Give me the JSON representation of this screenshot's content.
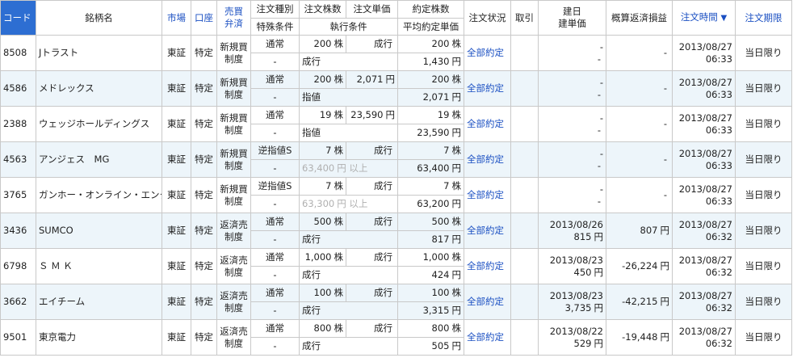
{
  "headers": {
    "code": "コード",
    "name": "銘柄名",
    "market": "市場",
    "account": "口座",
    "buysell_line1": "売買",
    "buysell_line2": "弁済",
    "order_type": "注文種別",
    "special": "特殊条件",
    "qty": "注文株数",
    "exec_cond": "執行条件",
    "price": "注文単価",
    "filled_qty": "約定株数",
    "avg_price": "平均約定単価",
    "status": "注文状況",
    "cancel": "取引",
    "open_date_line1": "建日",
    "open_date_line2": "建単価",
    "pnl": "概算返済損益",
    "order_time": "注文時間",
    "sort_arrow": "▼",
    "expiry": "注文期限"
  },
  "rows": [
    {
      "code": "8508",
      "name": "Jトラスト",
      "market": "東証",
      "account": "特定",
      "side1": "新規買",
      "side2": "制度",
      "order_type": "通常",
      "special": "-",
      "qty": "200",
      "qty_unit": "株",
      "price": "成行",
      "price_unit": "",
      "exec": "成行",
      "exec_price": "",
      "exec_price_unit": "",
      "filled": "200",
      "filled_unit": "株",
      "avg": "1,430",
      "avg_unit": "円",
      "status": "全部約定",
      "open_date": "-",
      "open_price": "-",
      "open_price_unit": "",
      "pnl": "-",
      "pnl_unit": "",
      "date": "2013/08/27",
      "time": "06:33",
      "expiry": "当日限り"
    },
    {
      "code": "4586",
      "name": "メドレックス",
      "market": "東証",
      "account": "特定",
      "side1": "新規買",
      "side2": "制度",
      "order_type": "通常",
      "special": "-",
      "qty": "200",
      "qty_unit": "株",
      "price": "2,071",
      "price_unit": "円",
      "exec": "指値",
      "exec_price": "",
      "exec_price_unit": "",
      "filled": "200",
      "filled_unit": "株",
      "avg": "2,071",
      "avg_unit": "円",
      "status": "全部約定",
      "open_date": "-",
      "open_price": "-",
      "open_price_unit": "",
      "pnl": "-",
      "pnl_unit": "",
      "date": "2013/08/27",
      "time": "06:33",
      "expiry": "当日限り"
    },
    {
      "code": "2388",
      "name": "ウェッジホールディングス",
      "market": "東証",
      "account": "特定",
      "side1": "新規買",
      "side2": "制度",
      "order_type": "通常",
      "special": "-",
      "qty": "19",
      "qty_unit": "株",
      "price": "23,590",
      "price_unit": "円",
      "exec": "指値",
      "exec_price": "",
      "exec_price_unit": "",
      "filled": "19",
      "filled_unit": "株",
      "avg": "23,590",
      "avg_unit": "円",
      "status": "全部約定",
      "open_date": "-",
      "open_price": "-",
      "open_price_unit": "",
      "pnl": "-",
      "pnl_unit": "",
      "date": "2013/08/27",
      "time": "06:33",
      "expiry": "当日限り"
    },
    {
      "code": "4563",
      "name": "アンジェス　MG",
      "market": "東証",
      "account": "特定",
      "side1": "新規買",
      "side2": "制度",
      "order_type": "逆指値S",
      "special": "-",
      "qty": "7",
      "qty_unit": "株",
      "price": "成行",
      "price_unit": "",
      "exec": "",
      "exec_price": "63,400",
      "exec_price_unit": "円 以上",
      "filled": "7",
      "filled_unit": "株",
      "avg": "63,400",
      "avg_unit": "円",
      "status": "全部約定",
      "open_date": "-",
      "open_price": "-",
      "open_price_unit": "",
      "pnl": "-",
      "pnl_unit": "",
      "date": "2013/08/27",
      "time": "06:33",
      "expiry": "当日限り"
    },
    {
      "code": "3765",
      "name": "ガンホー・オンライン・エンター",
      "market": "東証",
      "account": "特定",
      "side1": "新規買",
      "side2": "制度",
      "order_type": "逆指値S",
      "special": "-",
      "qty": "7",
      "qty_unit": "株",
      "price": "成行",
      "price_unit": "",
      "exec": "",
      "exec_price": "63,300",
      "exec_price_unit": "円 以上",
      "filled": "7",
      "filled_unit": "株",
      "avg": "63,200",
      "avg_unit": "円",
      "status": "全部約定",
      "open_date": "-",
      "open_price": "-",
      "open_price_unit": "",
      "pnl": "-",
      "pnl_unit": "",
      "date": "2013/08/27",
      "time": "06:33",
      "expiry": "当日限り"
    },
    {
      "code": "3436",
      "name": "SUMCO",
      "market": "東証",
      "account": "特定",
      "side1": "返済売",
      "side2": "制度",
      "order_type": "通常",
      "special": "-",
      "qty": "500",
      "qty_unit": "株",
      "price": "成行",
      "price_unit": "",
      "exec": "成行",
      "exec_price": "",
      "exec_price_unit": "",
      "filled": "500",
      "filled_unit": "株",
      "avg": "817",
      "avg_unit": "円",
      "status": "全部約定",
      "open_date": "2013/08/26",
      "open_price": "815",
      "open_price_unit": "円",
      "pnl": "807",
      "pnl_unit": "円",
      "date": "2013/08/27",
      "time": "06:32",
      "expiry": "当日限り"
    },
    {
      "code": "6798",
      "name": "Ｓ Ｍ Ｋ",
      "market": "東証",
      "account": "特定",
      "side1": "返済売",
      "side2": "制度",
      "order_type": "通常",
      "special": "-",
      "qty": "1,000",
      "qty_unit": "株",
      "price": "成行",
      "price_unit": "",
      "exec": "成行",
      "exec_price": "",
      "exec_price_unit": "",
      "filled": "1,000",
      "filled_unit": "株",
      "avg": "424",
      "avg_unit": "円",
      "status": "全部約定",
      "open_date": "2013/08/23",
      "open_price": "450",
      "open_price_unit": "円",
      "pnl": "-26,224",
      "pnl_unit": "円",
      "date": "2013/08/27",
      "time": "06:32",
      "expiry": "当日限り"
    },
    {
      "code": "3662",
      "name": "エイチーム",
      "market": "東証",
      "account": "特定",
      "side1": "返済売",
      "side2": "制度",
      "order_type": "通常",
      "special": "-",
      "qty": "100",
      "qty_unit": "株",
      "price": "成行",
      "price_unit": "",
      "exec": "成行",
      "exec_price": "",
      "exec_price_unit": "",
      "filled": "100",
      "filled_unit": "株",
      "avg": "3,315",
      "avg_unit": "円",
      "status": "全部約定",
      "open_date": "2013/08/23",
      "open_price": "3,735",
      "open_price_unit": "円",
      "pnl": "-42,215",
      "pnl_unit": "円",
      "date": "2013/08/27",
      "time": "06:32",
      "expiry": "当日限り"
    },
    {
      "code": "9501",
      "name": "東京電力",
      "market": "東証",
      "account": "特定",
      "side1": "返済売",
      "side2": "制度",
      "order_type": "通常",
      "special": "-",
      "qty": "800",
      "qty_unit": "株",
      "price": "成行",
      "price_unit": "",
      "exec": "成行",
      "exec_price": "",
      "exec_price_unit": "",
      "filled": "800",
      "filled_unit": "株",
      "avg": "505",
      "avg_unit": "円",
      "status": "全部約定",
      "open_date": "2013/08/22",
      "open_price": "529",
      "open_price_unit": "円",
      "pnl": "-19,448",
      "pnl_unit": "円",
      "date": "2013/08/27",
      "time": "06:32",
      "expiry": "当日限り"
    }
  ]
}
